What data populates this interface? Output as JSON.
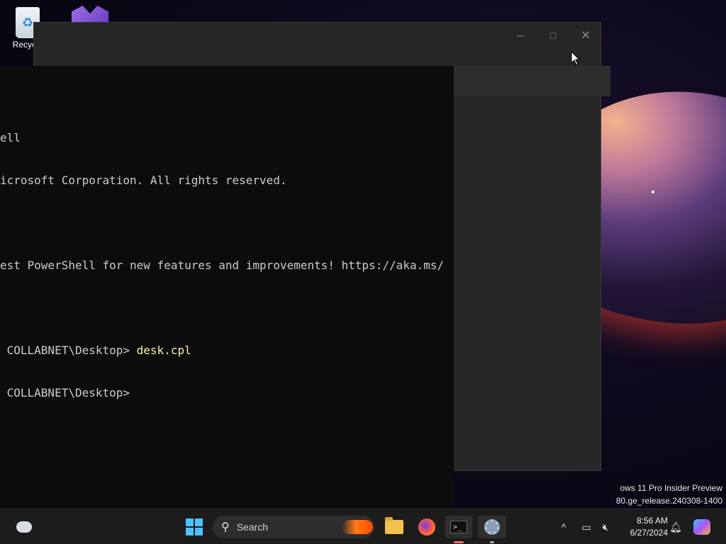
{
  "desktop": {
    "icons": [
      {
        "label": "Recycle",
        "icon": "recycle-bin-icon"
      },
      {
        "label": "",
        "icon": "visual-studio-icon"
      }
    ],
    "watermark": {
      "line1": "ows 11 Pro Insider Preview",
      "line2": "80.ge_release.240308-1400"
    }
  },
  "dialog": {
    "controls": {
      "minimize": "─",
      "maximize": "□",
      "close": "✕"
    }
  },
  "terminal": {
    "tab": {
      "close": "✕"
    },
    "new_tab": "+",
    "dropdown": "⌄",
    "lines": [
      {
        "text": "ell",
        "cmd": ""
      },
      {
        "text": "icrosoft Corporation. All rights reserved.",
        "cmd": ""
      },
      {
        "text": "",
        "cmd": ""
      },
      {
        "text": "est PowerShell for new features and improvements! https://aka.ms/",
        "cmd": ""
      },
      {
        "text": "",
        "cmd": ""
      },
      {
        "text": " COLLABNET\\Desktop> ",
        "cmd": "desk.cpl"
      },
      {
        "text": " COLLABNET\\Desktop> ",
        "cmd": ""
      }
    ]
  },
  "taskbar": {
    "search_label": "Search",
    "time": "8:56 AM",
    "date": "6/27/2024",
    "chevron": "^",
    "apps": [
      "weather-icon",
      "start-icon",
      "file-explorer-icon",
      "firefox-icon",
      "terminal-icon",
      "settings-icon",
      "copilot-icon"
    ]
  }
}
